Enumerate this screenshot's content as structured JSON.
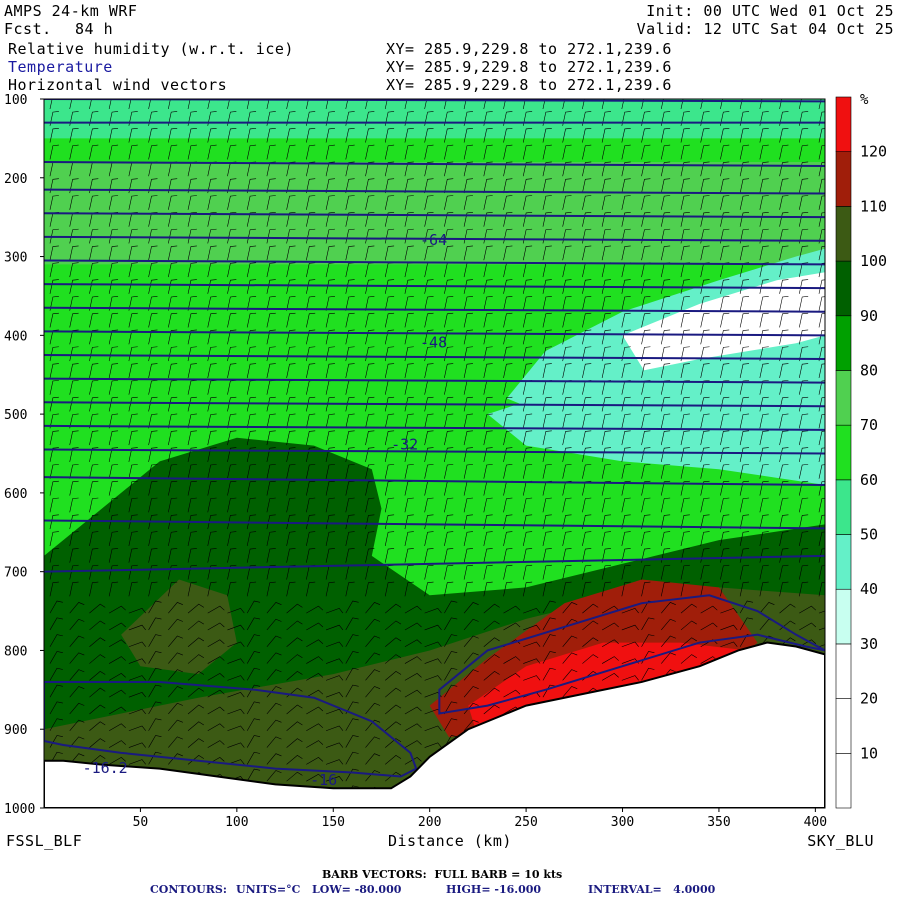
{
  "header": {
    "model": "AMPS 24-km WRF",
    "fcst_label": "Fcst.",
    "fcst_value": "84 h",
    "init": "Init: 00 UTC Wed 01 Oct 25",
    "valid": "Valid: 12 UTC Sat 04 Oct 25",
    "fields": [
      {
        "name": "Relative humidity (w.r.t. ice)",
        "xy": "XY= 285.9,229.8 to 272.1,239.6"
      },
      {
        "name": "Temperature",
        "xy": "XY= 285.9,229.8 to 272.1,239.6"
      },
      {
        "name": "Horizontal wind vectors",
        "xy": "XY= 285.9,229.8 to 272.1,239.6"
      }
    ]
  },
  "colors": {
    "temperature_contour": "#1a1a80",
    "humidity_scale": [
      "#ffffff",
      "#ffffff",
      "#ffffff",
      "#c8fff0",
      "#64f0c8",
      "#3ce68c",
      "#20e020",
      "#50d050",
      "#00a000",
      "#006000",
      "#3c5a14",
      "#a01e0a",
      "#f01010"
    ]
  },
  "footer": {
    "left_label": "FSSL_BLF",
    "right_label": "SKY_BLU",
    "xlabel": "Distance (km)",
    "barb_note": "BARB VECTORS:  FULL BARB = 10 kts",
    "contours_label": "CONTOURS:",
    "units": "UNITS=°C",
    "low": "LOW= -80.000",
    "high": "HIGH= -16.000",
    "interval": "INTERVAL=   4.0000"
  },
  "chart_data": {
    "type": "heatmap",
    "x_ticks": [
      50,
      100,
      150,
      200,
      250,
      300,
      350,
      400
    ],
    "xlim": [
      0,
      405
    ],
    "y_ticks": [
      100,
      200,
      300,
      400,
      500,
      600,
      700,
      800,
      900,
      1000
    ],
    "ylim": [
      100,
      1000
    ],
    "y_reversed": true,
    "colorbar": {
      "unit": "%",
      "bounds": [
        0,
        10,
        20,
        30,
        40,
        50,
        60,
        70,
        80,
        90,
        100,
        110,
        120,
        130
      ],
      "tick_labels": [
        "10",
        "20",
        "30",
        "40",
        "50",
        "60",
        "70",
        "80",
        "90",
        "100",
        "110",
        "120"
      ]
    },
    "humidity_regions": [
      {
        "name": "moist-upper-band",
        "rh": 75,
        "x": [
          0,
          405,
          405,
          0
        ],
        "y": [
          180,
          180,
          310,
          310
        ]
      },
      {
        "name": "top-layer",
        "rh": 55,
        "x": [
          0,
          405,
          405,
          0
        ],
        "y": [
          100,
          100,
          150,
          150
        ]
      },
      {
        "name": "dry-tongue-upper",
        "rh": 45,
        "x": [
          260,
          300,
          350,
          390,
          405,
          405,
          380,
          330,
          280,
          240
        ],
        "y": [
          420,
          370,
          330,
          300,
          290,
          470,
          520,
          540,
          520,
          480
        ]
      },
      {
        "name": "dry-core",
        "rh": 25,
        "x": [
          300,
          340,
          380,
          405,
          405,
          370,
          320
        ],
        "y": [
          400,
          360,
          330,
          320,
          470,
          500,
          480
        ]
      },
      {
        "name": "dry-tongue-lower",
        "rh": 45,
        "x": [
          230,
          280,
          340,
          390,
          405,
          405,
          350,
          300,
          250
        ],
        "y": [
          500,
          460,
          430,
          410,
          400,
          590,
          570,
          560,
          540
        ]
      },
      {
        "name": "moist-low-left",
        "rh": 95,
        "x": [
          0,
          30,
          60,
          100,
          140,
          170,
          175,
          170,
          200,
          250,
          300,
          350,
          405,
          405,
          0
        ],
        "y": [
          680,
          620,
          560,
          530,
          540,
          570,
          620,
          680,
          730,
          720,
          690,
          660,
          640,
          1000,
          1000
        ]
      },
      {
        "name": "saturated-left",
        "rh": 105,
        "x": [
          40,
          70,
          95,
          100,
          80,
          50
        ],
        "y": [
          780,
          710,
          730,
          790,
          830,
          820
        ]
      },
      {
        "name": "saturated-lowlands",
        "rh": 105,
        "x": [
          0,
          80,
          150,
          200,
          250,
          300,
          350,
          405,
          405,
          0
        ],
        "y": [
          900,
          860,
          830,
          800,
          760,
          730,
          720,
          730,
          1000,
          1000
        ]
      },
      {
        "name": "supersaturated-slope",
        "rh": 115,
        "x": [
          200,
          230,
          270,
          310,
          350,
          370,
          350,
          300,
          250,
          210
        ],
        "y": [
          870,
          810,
          740,
          710,
          720,
          790,
          830,
          860,
          900,
          910
        ]
      },
      {
        "name": "supersaturated-core",
        "rh": 125,
        "x": [
          220,
          250,
          290,
          330,
          365,
          345,
          300,
          260,
          225
        ],
        "y": [
          870,
          820,
          790,
          790,
          800,
          830,
          850,
          890,
          910
        ]
      }
    ],
    "terrain": {
      "x": [
        0,
        10,
        30,
        60,
        90,
        120,
        150,
        180,
        190,
        200,
        220,
        250,
        280,
        310,
        340,
        360,
        375,
        390,
        405
      ],
      "p": [
        940,
        940,
        945,
        950,
        960,
        970,
        975,
        975,
        960,
        935,
        900,
        870,
        855,
        840,
        820,
        800,
        790,
        795,
        805
      ]
    },
    "temperature_isotherms": [
      {
        "level_p": 100,
        "slope": 3
      },
      {
        "level_p": 130,
        "slope": 0
      },
      {
        "level_p": 180,
        "slope": 5
      },
      {
        "level_p": 215,
        "slope": 5
      },
      {
        "level_p": 245,
        "slope": 5
      },
      {
        "level_p": 275,
        "slope": 5
      },
      {
        "level_p": 305,
        "slope": 5
      },
      {
        "level_p": 335,
        "slope": 5
      },
      {
        "level_p": 365,
        "slope": 5
      },
      {
        "level_p": 395,
        "slope": 5
      },
      {
        "level_p": 425,
        "slope": 5
      },
      {
        "level_p": 455,
        "slope": 5
      },
      {
        "level_p": 485,
        "slope": 5
      },
      {
        "level_p": 515,
        "slope": 5
      },
      {
        "level_p": 545,
        "slope": 5
      },
      {
        "level_p": 580,
        "slope": 10
      },
      {
        "level_p": 635,
        "slope": 10
      },
      {
        "level_p": 700,
        "slope": -20
      }
    ],
    "warm_contours": [
      {
        "x": [
          0,
          60,
          110,
          140,
          170,
          190,
          193,
          185,
          160,
          120,
          80,
          40,
          10,
          0
        ],
        "p": [
          840,
          840,
          850,
          860,
          890,
          930,
          950,
          960,
          955,
          950,
          940,
          930,
          920,
          915
        ]
      },
      {
        "x": [
          205,
          230,
          270,
          310,
          345,
          370,
          390,
          405,
          395,
          370,
          340,
          300,
          260,
          230,
          205
        ],
        "p": [
          850,
          800,
          770,
          740,
          730,
          750,
          780,
          800,
          795,
          780,
          790,
          820,
          850,
          870,
          880
        ]
      }
    ],
    "contour_labels": [
      {
        "text": "-64",
        "x": 195,
        "p": 278
      },
      {
        "text": "-48",
        "x": 195,
        "p": 408
      },
      {
        "text": "-32",
        "x": 180,
        "p": 537
      },
      {
        "text": "-16",
        "x": 138,
        "p": 963
      },
      {
        "text": "-16.2",
        "x": 20,
        "p": 948
      }
    ]
  }
}
